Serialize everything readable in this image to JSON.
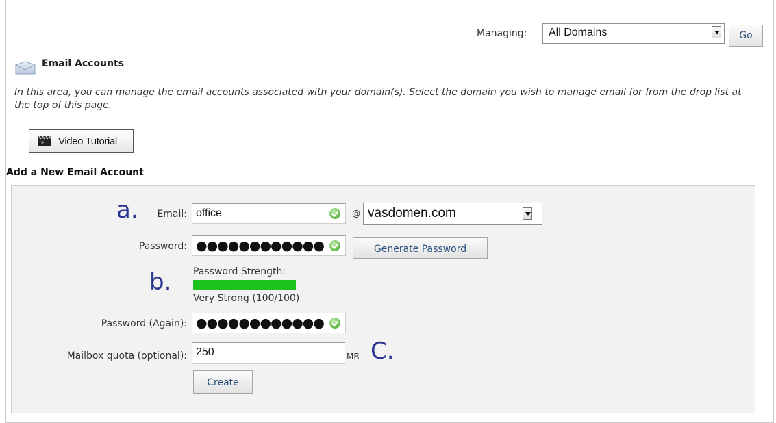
{
  "header": {
    "managing_label": "Managing:",
    "domain_select": "All Domains",
    "go_label": "Go"
  },
  "section": {
    "title": "Email Accounts",
    "intro": "In this area, you can manage the email accounts associated with your domain(s). Select the domain you wish to manage email for from the drop list at the top of this page.",
    "video_label": "Video Tutorial"
  },
  "form": {
    "title": "Add a New Email Account",
    "email_label": "Email:",
    "email_value": "office",
    "at_sign": "@",
    "domain_value": "vasdomen.com",
    "password_label": "Password:",
    "password_value": "●●●●●●●●●●●●",
    "generate_label": "Generate Password",
    "strength_title": "Password Strength:",
    "strength_text": "Very Strong (100/100)",
    "strength_percent": 100,
    "password_again_label": "Password (Again):",
    "password_again_value": "●●●●●●●●●●●●",
    "quota_label": "Mailbox quota (optional):",
    "quota_value": "250",
    "quota_unit": "MB",
    "create_label": "Create"
  },
  "markers": {
    "a": "a.",
    "b": "b.",
    "c": "C."
  },
  "colors": {
    "marker": "#2a3690",
    "strength_fill": "#1ec21e",
    "button_text": "#2a4f7d",
    "panel_bg": "#f2f2f2"
  },
  "icons": {
    "valid": "check-circle-icon",
    "mail": "envelope-icon",
    "video": "clapperboard-icon"
  }
}
